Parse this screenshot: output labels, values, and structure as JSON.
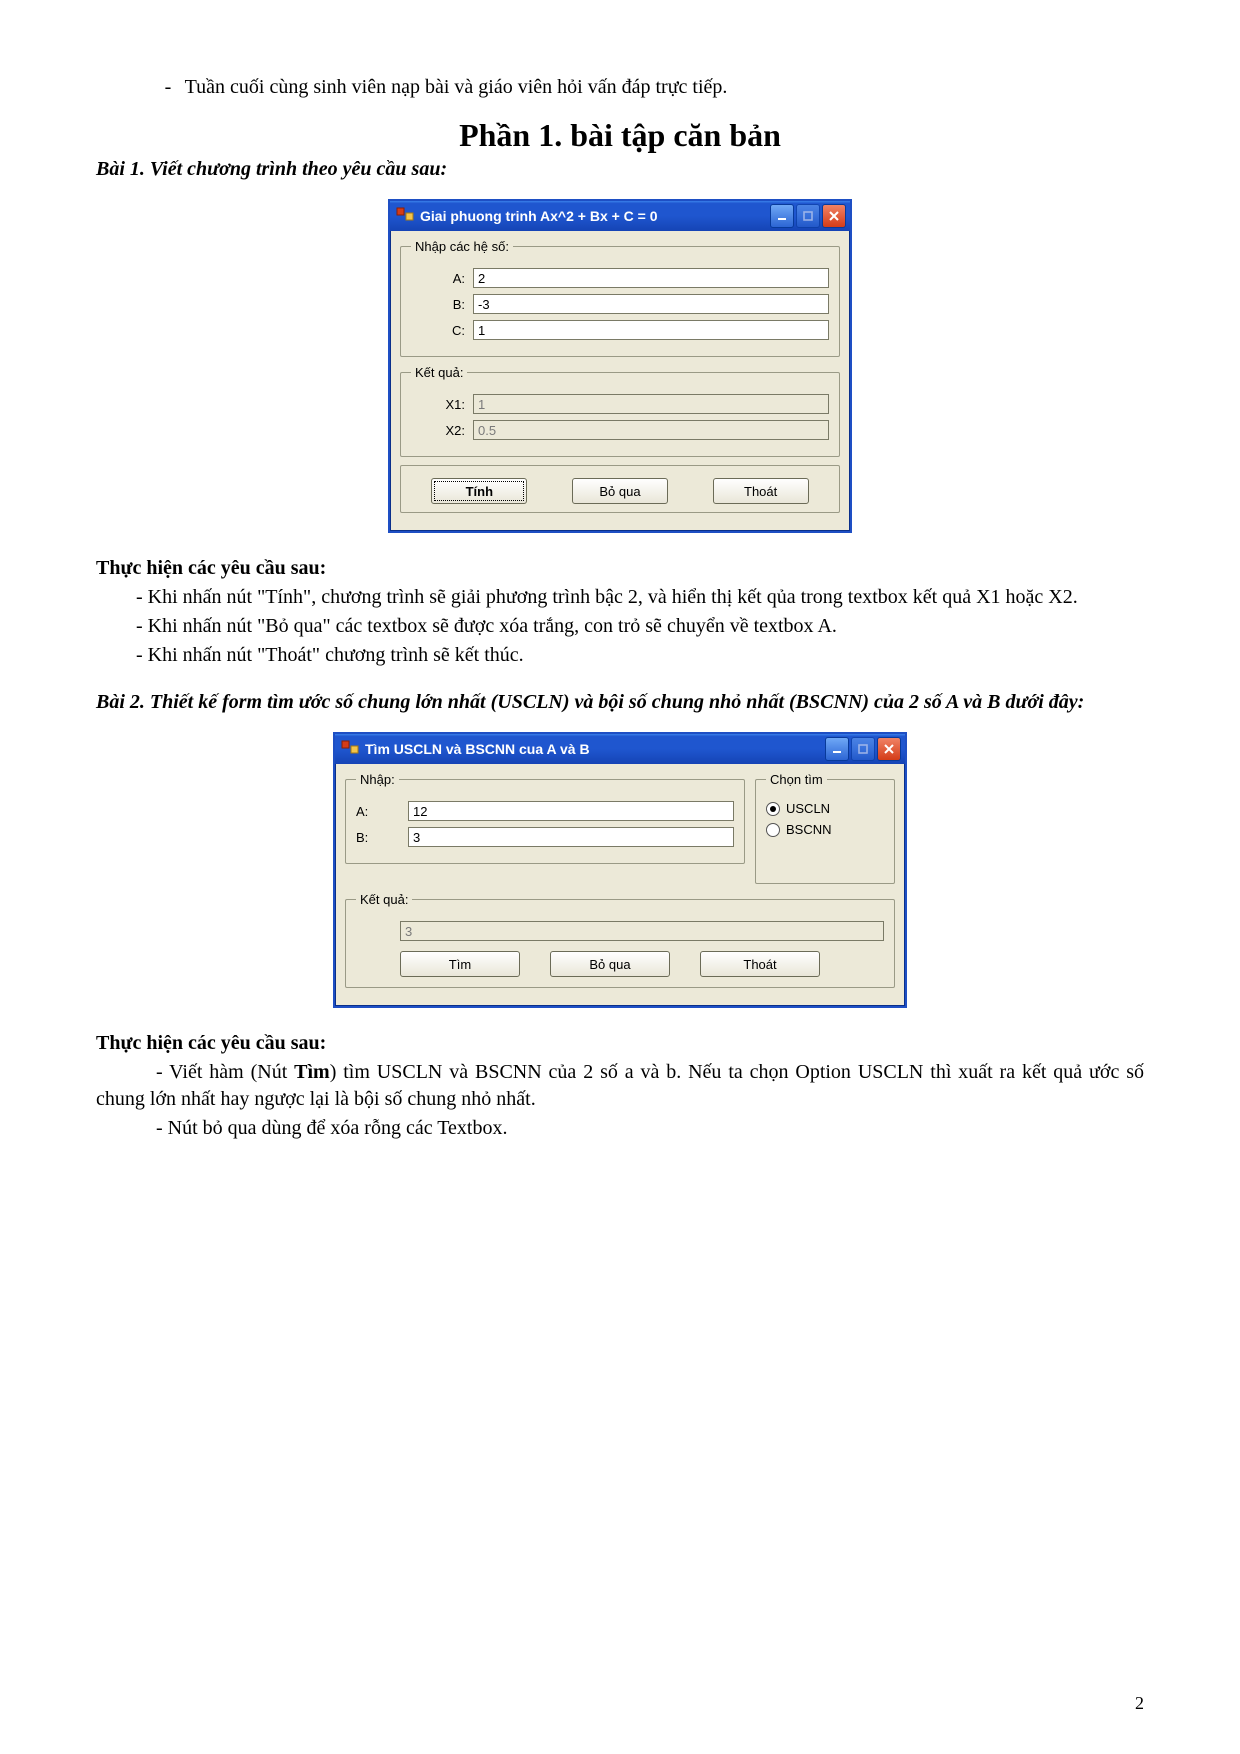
{
  "intro_bullet": "Tuần cuối cùng sinh viên nạp bài và giáo viên hỏi vấn đáp trực tiếp.",
  "main_title": "Phần 1. bài tập căn bản",
  "ex1": {
    "title": "Bài 1. Viết chương trình theo yêu cầu sau:",
    "window_title": "Giai phuong trinh Ax^2 + Bx + C = 0",
    "group_input": "Nhập các hệ số:",
    "labelA": "A:",
    "labelB": "B:",
    "labelC": "C:",
    "valA": "2",
    "valB": "-3",
    "valC": "1",
    "group_result": "Kết quả:",
    "labelX1": "X1:",
    "labelX2": "X2:",
    "valX1": "1",
    "valX2": "0.5",
    "btn_calc": "Tính",
    "btn_skip": "Bỏ qua",
    "btn_exit": "Thoát",
    "req_heading": "Thực hiện các yêu cầu sau:",
    "req1": "- Khi nhấn nút \"Tính\", chương trình sẽ giải phương trình bậc 2, và hiển thị kết qủa trong textbox kết quả X1 hoặc X2.",
    "req2": "- Khi nhấn nút \"Bỏ qua\" các textbox sẽ được xóa trắng, con trỏ sẽ chuyển về textbox A.",
    "req3": "- Khi nhấn nút \"Thoát\" chương trình sẽ kết thúc."
  },
  "ex2": {
    "title": "Bài 2. Thiết kế form tìm ước số chung lớn nhất (USCLN) và bội số chung nhỏ nhất (BSCNN) của 2 số A và B dưới đây:",
    "window_title": "Tìm USCLN và BSCNN cua A và B",
    "group_input": "Nhập:",
    "labelA": "A:",
    "labelB": "B:",
    "valA": "12",
    "valB": "3",
    "group_choice": "Chọn tìm",
    "opt1": "USCLN",
    "opt2": "BSCNN",
    "group_result": "Kết quả:",
    "valResult": "3",
    "btn_find": "Tìm",
    "btn_skip": "Bỏ qua",
    "btn_exit": "Thoát",
    "req_heading": "Thực hiện các yêu cầu sau:",
    "req1_pre": "- Viết hàm (Nút ",
    "req1_bold": "Tìm",
    "req1_post": ") tìm USCLN và BSCNN của 2 số a và b. Nếu ta chọn Option USCLN thì xuất ra kết quả ước số chung lớn nhất hay ngược lại là bội số chung nhỏ nhất.",
    "req2": "- Nút bỏ qua dùng để xóa rỗng các Textbox."
  },
  "page_number": "2"
}
